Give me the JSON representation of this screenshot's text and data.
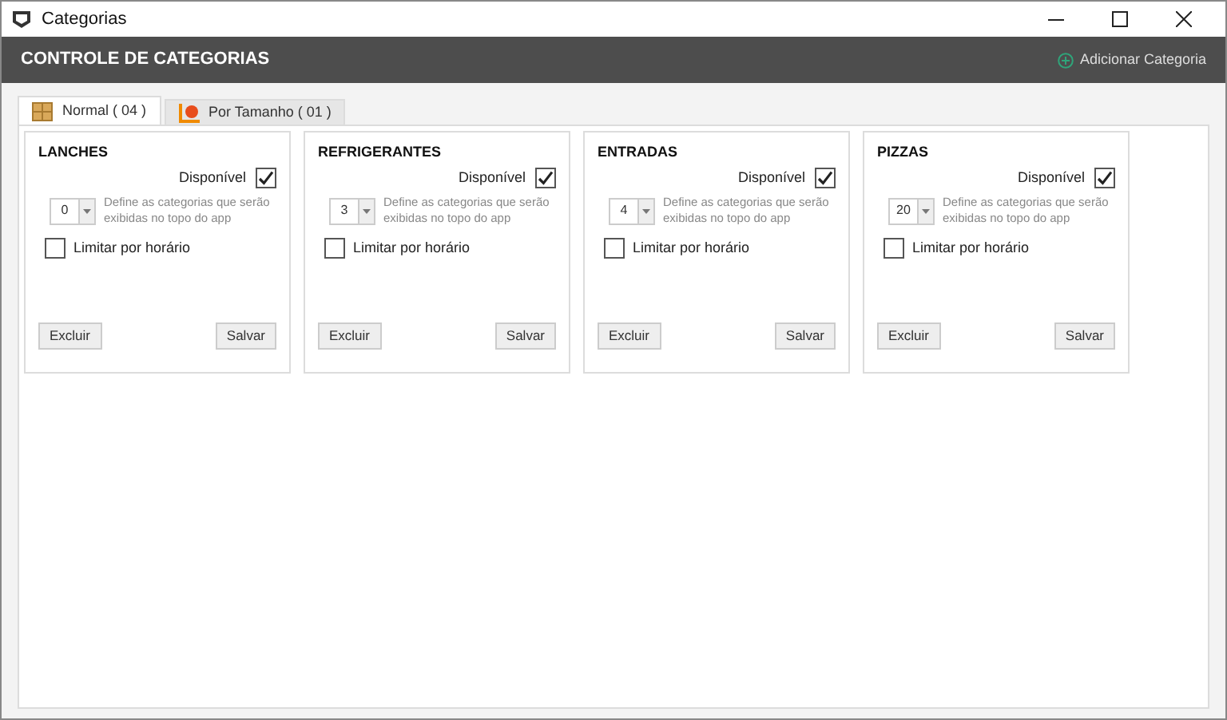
{
  "window": {
    "title": "Categorias"
  },
  "header": {
    "title": "CONTROLE DE CATEGORIAS",
    "add_button": "Adicionar Categoria"
  },
  "tabs": [
    {
      "label": "Normal ( 04 )",
      "selected": true,
      "kind": "normal"
    },
    {
      "label": "Por Tamanho ( 01 )",
      "selected": false,
      "kind": "size"
    }
  ],
  "categories": [
    {
      "name": "LANCHES",
      "available_label": "Disponível",
      "available": true,
      "order": "0",
      "order_hint": "Define as categorias que serão exibidas no topo do app",
      "limit_label": "Limitar por horário",
      "limit": false,
      "delete": "Excluir",
      "save": "Salvar"
    },
    {
      "name": "REFRIGERANTES",
      "available_label": "Disponível",
      "available": true,
      "order": "3",
      "order_hint": "Define as categorias que serão exibidas no topo do app",
      "limit_label": "Limitar por horário",
      "limit": false,
      "delete": "Excluir",
      "save": "Salvar"
    },
    {
      "name": "ENTRADAS",
      "available_label": "Disponível",
      "available": true,
      "order": "4",
      "order_hint": "Define as categorias que serão exibidas no topo do app",
      "limit_label": "Limitar por horário",
      "limit": false,
      "delete": "Excluir",
      "save": "Salvar"
    },
    {
      "name": "PIZZAS",
      "available_label": "Disponível",
      "available": true,
      "order": "20",
      "order_hint": "Define as categorias que serão exibidas no topo do app",
      "limit_label": "Limitar por horário",
      "limit": false,
      "delete": "Excluir",
      "save": "Salvar"
    }
  ]
}
